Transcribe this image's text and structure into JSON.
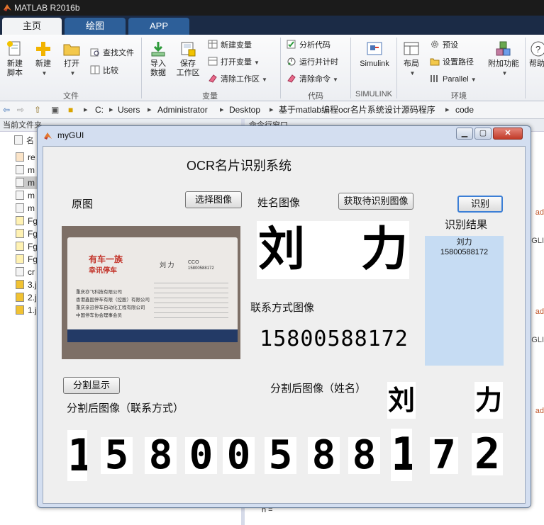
{
  "app": {
    "title": "MATLAB R2016b"
  },
  "tabs": [
    {
      "label": "主页"
    },
    {
      "label": "绘图"
    },
    {
      "label": "APP"
    }
  ],
  "ribbon": {
    "new_script": "新建\n脚本",
    "new": "新建",
    "open": "打开",
    "find_files": "查找文件",
    "compare": "比较",
    "import_data": "导入\n数据",
    "save_workspace": "保存\n工作区",
    "new_variable": "新建变量",
    "open_variable": "打开变量",
    "clear_workspace": "清除工作区",
    "analyze_code": "分析代码",
    "run_and_time": "运行并计时",
    "clear_commands": "清除命令",
    "simulink": "Simulink",
    "layout": "布局",
    "preferences": "预设",
    "set_path": "设置路径",
    "parallel": "Parallel",
    "addons": "附加功能",
    "help": "帮助",
    "groups": [
      "文件",
      "变量",
      "代码",
      "SIMULINK",
      "环境"
    ]
  },
  "address": {
    "crumbs": [
      "C:",
      "Users",
      "Administrator",
      "Desktop",
      "基于matlab编程ocr名片系统设计源码程序",
      "code"
    ]
  },
  "current_folder": {
    "title": "当前文件夹",
    "header_name": "名",
    "files": [
      "re",
      "m",
      "m",
      "m",
      "m",
      "Fg",
      "Fg",
      "Fg",
      "Fg",
      "cr",
      "3.j",
      "2.j",
      "1.j"
    ]
  },
  "command_window": {
    "title": "命令行窗口",
    "side_labels": [
      "ad",
      "GLI",
      "ad",
      "GLI",
      "ad"
    ],
    "prompt": "n ="
  },
  "gui": {
    "window_title": "myGUI",
    "header": "OCR名片识别系统",
    "original_label": "原图",
    "select_button": "选择图像",
    "name_image_label": "姓名图像",
    "get_image_button": "获取待识别图像",
    "recognize_button": "识别",
    "result_label": "识别结果",
    "result_lines": [
      "刘力",
      "15800588172"
    ],
    "contact_image_label": "联系方式图像",
    "contact_image_text": "15800588172",
    "name_chars": [
      "刘",
      "力"
    ],
    "split_button": "分割显示",
    "split_name_label": "分割后图像（姓名）",
    "split_contact_label": "分割后图像（联系方式）",
    "split_digits": [
      "1",
      "5",
      "8",
      "0",
      "0",
      "5",
      "8",
      "8",
      "1",
      "7",
      "2"
    ],
    "card": {
      "company_logo": "有车一族",
      "company_sub": "幸讯停车",
      "person": "刘 力",
      "role": "CCO",
      "phone": "15800588172",
      "lines": [
        "重庆亦飞科技有限公司",
        "香港鑫固停车有限（控股）有限公司",
        "重庆亲迅停车自动化工程有限公司",
        "中国停车协会理事会员"
      ]
    }
  }
}
